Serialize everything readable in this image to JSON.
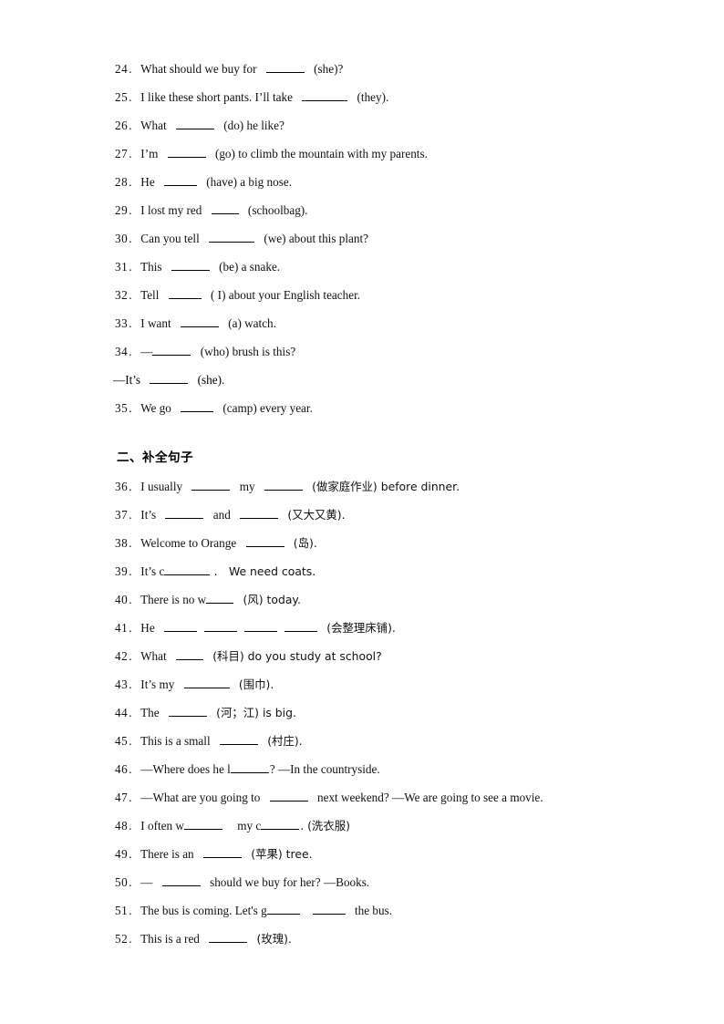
{
  "page": {
    "background": "#ffffff",
    "text_color": "#000000"
  },
  "section_one": {
    "items": [
      {
        "num": "24",
        "pre": "What should we buy for",
        "mid": "",
        "post": "(she)?"
      },
      {
        "num": "25",
        "pre": "I like these short pants. I’ll take",
        "mid": "",
        "post": "(they)."
      },
      {
        "num": "26",
        "pre": "What",
        "mid": "",
        "post": "(do) he like?"
      },
      {
        "num": "27",
        "pre": "I’m",
        "mid": "",
        "post": "(go) to climb the mountain with my parents."
      },
      {
        "num": "28",
        "pre": "He",
        "mid": "",
        "post": "(have) a big nose."
      },
      {
        "num": "29",
        "pre": "I lost my red",
        "mid": "",
        "post": "(schoolbag)."
      },
      {
        "num": "30",
        "pre": "Can you tell",
        "mid": "",
        "post": "(we) about this plant?"
      },
      {
        "num": "31",
        "pre": "This",
        "mid": "",
        "post": "(be) a snake."
      },
      {
        "num": "32",
        "pre": "Tell",
        "mid": "",
        "post": "( I) about your English teacher."
      },
      {
        "num": "33",
        "pre": "I want",
        "mid": "",
        "post": "(a) watch."
      },
      {
        "num": "34",
        "pre": "—",
        "mid": "",
        "post": "(who) brush is this?"
      }
    ],
    "continuation": {
      "pre": "—It’s",
      "post": "(she)."
    },
    "last_item": {
      "num": "35",
      "pre": "We go",
      "post": "(camp) every year."
    }
  },
  "section_two": {
    "heading": "二、补全句子",
    "items": [
      {
        "num": "36",
        "a": "I usually",
        "b": "my",
        "c": "(做家庭作业) before dinner."
      },
      {
        "num": "37",
        "a": "It’s",
        "b": "and",
        "c": "(又大又黄)."
      },
      {
        "num": "38",
        "a": "Welcome to Orange",
        "c": "(岛)."
      },
      {
        "num": "39",
        "a": "It’s c",
        "c": ". We need coats."
      },
      {
        "num": "40",
        "a": "There is no w",
        "c": "(风) today."
      },
      {
        "num": "41",
        "a": "He",
        "c": "(会整理床铺)."
      },
      {
        "num": "42",
        "a": "What",
        "c": "(科目) do you study at school?"
      },
      {
        "num": "43",
        "a": "It’s my",
        "c": "(围巾)."
      },
      {
        "num": "44",
        "a": "The",
        "c": "(河；江) is big."
      },
      {
        "num": "45",
        "a": "This is a small",
        "c": "(村庄)."
      },
      {
        "num": "46",
        "a": "—Where does he l",
        "c": "? —In the countryside."
      },
      {
        "num": "47",
        "a": "—What are you going to",
        "c": "next weekend? —We are going to see a movie."
      },
      {
        "num": "48",
        "a": "I often w",
        "b": "my c",
        "c": ". (洗衣服)"
      },
      {
        "num": "49",
        "a": "There is an",
        "c": "(苹果) tree."
      },
      {
        "num": "50",
        "a": "—",
        "c": "should we buy for her? —Books."
      },
      {
        "num": "51",
        "a": "The bus is coming. Let's g",
        "c": "the bus."
      },
      {
        "num": "52",
        "a": "This is a red",
        "c": "(玫瑰)."
      }
    ]
  }
}
